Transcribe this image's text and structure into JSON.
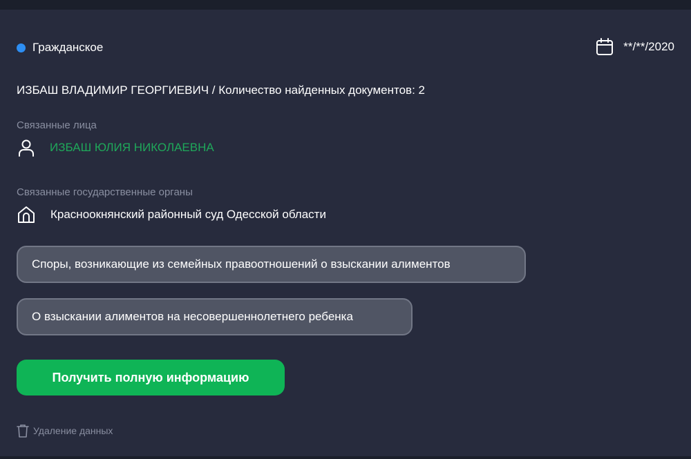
{
  "case": {
    "type_label": "Гражданское",
    "date": "**/**/2020",
    "title": "ИЗБАШ ВЛАДИМИР ГЕОРГИЕВИЧ / Количество найденных документов: 2"
  },
  "related_persons": {
    "label": "Связанные лица",
    "items": [
      {
        "name": "ИЗБАШ ЮЛИЯ НИКОЛАЕВНА",
        "icon": "person-icon"
      }
    ]
  },
  "related_bodies": {
    "label": "Связанные государственные органы",
    "items": [
      {
        "name": "Красноокнянский районный суд Одесской области",
        "icon": "building-icon"
      }
    ]
  },
  "categories": [
    "Споры, возникающие из семейных правоотношений о взыскании алиментов",
    "О взыскании алиментов на несовершеннолетнего ребенка"
  ],
  "actions": {
    "full_info_label": "Получить полную информацию",
    "delete_label": "Удаление данных"
  },
  "colors": {
    "background": "#1b1f2b",
    "card": "#272b3d",
    "accent_dot": "#2d8ef3",
    "person_name": "#1fa85a",
    "primary_button": "#0fb456",
    "muted_text": "#8a8fa1"
  }
}
